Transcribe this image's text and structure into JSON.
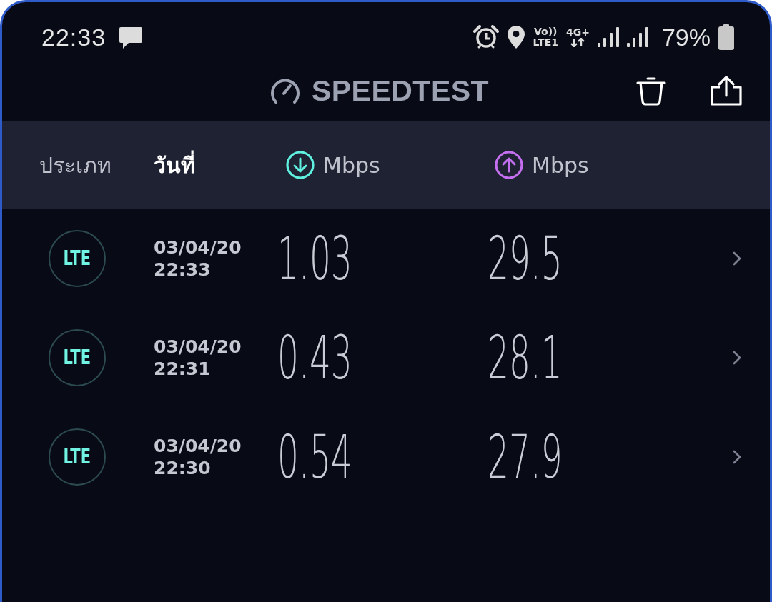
{
  "status_bar": {
    "time": "22:33",
    "volte": {
      "top": "Vo))",
      "bottom": "LTE1"
    },
    "network": "4G+",
    "battery": "79%"
  },
  "app_bar": {
    "title": "SPEEDTEST"
  },
  "columns": [
    {
      "kind": "text",
      "label": "ประเภท",
      "selected": false
    },
    {
      "kind": "text",
      "label": "วันที่",
      "selected": true
    },
    {
      "kind": "download",
      "label": "Mbps",
      "selected": false
    },
    {
      "kind": "upload",
      "label": "Mbps",
      "selected": false
    }
  ],
  "results": [
    {
      "type": "LTE",
      "date": "03/04/20",
      "time": "22:33",
      "download": "1.03",
      "upload": "29.5"
    },
    {
      "type": "LTE",
      "date": "03/04/20",
      "time": "22:31",
      "download": "0.43",
      "upload": "28.1"
    },
    {
      "type": "LTE",
      "date": "03/04/20",
      "time": "22:30",
      "download": "0.54",
      "upload": "27.9"
    }
  ]
}
